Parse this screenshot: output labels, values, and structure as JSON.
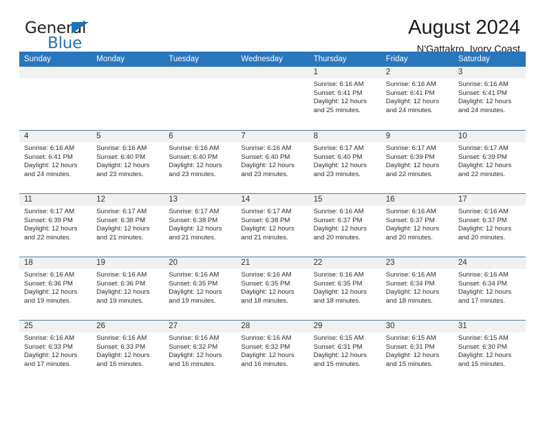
{
  "brand": {
    "name_top": "General",
    "name_bottom": "Blue",
    "accent_color": "#1f73b7"
  },
  "header": {
    "title": "August 2024",
    "subtitle": "N'Gattakro, Ivory Coast"
  },
  "calendar": {
    "header_bg": "#2a76bd",
    "date_band_bg": "#f1f1f1",
    "row_border_color": "#4a7ba8",
    "weekdays": [
      "Sunday",
      "Monday",
      "Tuesday",
      "Wednesday",
      "Thursday",
      "Friday",
      "Saturday"
    ],
    "weeks": [
      [
        {
          "day": "",
          "sunrise": "",
          "sunset": "",
          "daylight_line1": "",
          "daylight_line2": ""
        },
        {
          "day": "",
          "sunrise": "",
          "sunset": "",
          "daylight_line1": "",
          "daylight_line2": ""
        },
        {
          "day": "",
          "sunrise": "",
          "sunset": "",
          "daylight_line1": "",
          "daylight_line2": ""
        },
        {
          "day": "",
          "sunrise": "",
          "sunset": "",
          "daylight_line1": "",
          "daylight_line2": ""
        },
        {
          "day": "1",
          "sunrise": "Sunrise: 6:16 AM",
          "sunset": "Sunset: 6:41 PM",
          "daylight_line1": "Daylight: 12 hours",
          "daylight_line2": "and 25 minutes."
        },
        {
          "day": "2",
          "sunrise": "Sunrise: 6:16 AM",
          "sunset": "Sunset: 6:41 PM",
          "daylight_line1": "Daylight: 12 hours",
          "daylight_line2": "and 24 minutes."
        },
        {
          "day": "3",
          "sunrise": "Sunrise: 6:16 AM",
          "sunset": "Sunset: 6:41 PM",
          "daylight_line1": "Daylight: 12 hours",
          "daylight_line2": "and 24 minutes."
        }
      ],
      [
        {
          "day": "4",
          "sunrise": "Sunrise: 6:16 AM",
          "sunset": "Sunset: 6:41 PM",
          "daylight_line1": "Daylight: 12 hours",
          "daylight_line2": "and 24 minutes."
        },
        {
          "day": "5",
          "sunrise": "Sunrise: 6:16 AM",
          "sunset": "Sunset: 6:40 PM",
          "daylight_line1": "Daylight: 12 hours",
          "daylight_line2": "and 23 minutes."
        },
        {
          "day": "6",
          "sunrise": "Sunrise: 6:16 AM",
          "sunset": "Sunset: 6:40 PM",
          "daylight_line1": "Daylight: 12 hours",
          "daylight_line2": "and 23 minutes."
        },
        {
          "day": "7",
          "sunrise": "Sunrise: 6:16 AM",
          "sunset": "Sunset: 6:40 PM",
          "daylight_line1": "Daylight: 12 hours",
          "daylight_line2": "and 23 minutes."
        },
        {
          "day": "8",
          "sunrise": "Sunrise: 6:17 AM",
          "sunset": "Sunset: 6:40 PM",
          "daylight_line1": "Daylight: 12 hours",
          "daylight_line2": "and 23 minutes."
        },
        {
          "day": "9",
          "sunrise": "Sunrise: 6:17 AM",
          "sunset": "Sunset: 6:39 PM",
          "daylight_line1": "Daylight: 12 hours",
          "daylight_line2": "and 22 minutes."
        },
        {
          "day": "10",
          "sunrise": "Sunrise: 6:17 AM",
          "sunset": "Sunset: 6:39 PM",
          "daylight_line1": "Daylight: 12 hours",
          "daylight_line2": "and 22 minutes."
        }
      ],
      [
        {
          "day": "11",
          "sunrise": "Sunrise: 6:17 AM",
          "sunset": "Sunset: 6:39 PM",
          "daylight_line1": "Daylight: 12 hours",
          "daylight_line2": "and 22 minutes."
        },
        {
          "day": "12",
          "sunrise": "Sunrise: 6:17 AM",
          "sunset": "Sunset: 6:38 PM",
          "daylight_line1": "Daylight: 12 hours",
          "daylight_line2": "and 21 minutes."
        },
        {
          "day": "13",
          "sunrise": "Sunrise: 6:17 AM",
          "sunset": "Sunset: 6:38 PM",
          "daylight_line1": "Daylight: 12 hours",
          "daylight_line2": "and 21 minutes."
        },
        {
          "day": "14",
          "sunrise": "Sunrise: 6:17 AM",
          "sunset": "Sunset: 6:38 PM",
          "daylight_line1": "Daylight: 12 hours",
          "daylight_line2": "and 21 minutes."
        },
        {
          "day": "15",
          "sunrise": "Sunrise: 6:16 AM",
          "sunset": "Sunset: 6:37 PM",
          "daylight_line1": "Daylight: 12 hours",
          "daylight_line2": "and 20 minutes."
        },
        {
          "day": "16",
          "sunrise": "Sunrise: 6:16 AM",
          "sunset": "Sunset: 6:37 PM",
          "daylight_line1": "Daylight: 12 hours",
          "daylight_line2": "and 20 minutes."
        },
        {
          "day": "17",
          "sunrise": "Sunrise: 6:16 AM",
          "sunset": "Sunset: 6:37 PM",
          "daylight_line1": "Daylight: 12 hours",
          "daylight_line2": "and 20 minutes."
        }
      ],
      [
        {
          "day": "18",
          "sunrise": "Sunrise: 6:16 AM",
          "sunset": "Sunset: 6:36 PM",
          "daylight_line1": "Daylight: 12 hours",
          "daylight_line2": "and 19 minutes."
        },
        {
          "day": "19",
          "sunrise": "Sunrise: 6:16 AM",
          "sunset": "Sunset: 6:36 PM",
          "daylight_line1": "Daylight: 12 hours",
          "daylight_line2": "and 19 minutes."
        },
        {
          "day": "20",
          "sunrise": "Sunrise: 6:16 AM",
          "sunset": "Sunset: 6:35 PM",
          "daylight_line1": "Daylight: 12 hours",
          "daylight_line2": "and 19 minutes."
        },
        {
          "day": "21",
          "sunrise": "Sunrise: 6:16 AM",
          "sunset": "Sunset: 6:35 PM",
          "daylight_line1": "Daylight: 12 hours",
          "daylight_line2": "and 18 minutes."
        },
        {
          "day": "22",
          "sunrise": "Sunrise: 6:16 AM",
          "sunset": "Sunset: 6:35 PM",
          "daylight_line1": "Daylight: 12 hours",
          "daylight_line2": "and 18 minutes."
        },
        {
          "day": "23",
          "sunrise": "Sunrise: 6:16 AM",
          "sunset": "Sunset: 6:34 PM",
          "daylight_line1": "Daylight: 12 hours",
          "daylight_line2": "and 18 minutes."
        },
        {
          "day": "24",
          "sunrise": "Sunrise: 6:16 AM",
          "sunset": "Sunset: 6:34 PM",
          "daylight_line1": "Daylight: 12 hours",
          "daylight_line2": "and 17 minutes."
        }
      ],
      [
        {
          "day": "25",
          "sunrise": "Sunrise: 6:16 AM",
          "sunset": "Sunset: 6:33 PM",
          "daylight_line1": "Daylight: 12 hours",
          "daylight_line2": "and 17 minutes."
        },
        {
          "day": "26",
          "sunrise": "Sunrise: 6:16 AM",
          "sunset": "Sunset: 6:33 PM",
          "daylight_line1": "Daylight: 12 hours",
          "daylight_line2": "and 16 minutes."
        },
        {
          "day": "27",
          "sunrise": "Sunrise: 6:16 AM",
          "sunset": "Sunset: 6:32 PM",
          "daylight_line1": "Daylight: 12 hours",
          "daylight_line2": "and 16 minutes."
        },
        {
          "day": "28",
          "sunrise": "Sunrise: 6:16 AM",
          "sunset": "Sunset: 6:32 PM",
          "daylight_line1": "Daylight: 12 hours",
          "daylight_line2": "and 16 minutes."
        },
        {
          "day": "29",
          "sunrise": "Sunrise: 6:15 AM",
          "sunset": "Sunset: 6:31 PM",
          "daylight_line1": "Daylight: 12 hours",
          "daylight_line2": "and 15 minutes."
        },
        {
          "day": "30",
          "sunrise": "Sunrise: 6:15 AM",
          "sunset": "Sunset: 6:31 PM",
          "daylight_line1": "Daylight: 12 hours",
          "daylight_line2": "and 15 minutes."
        },
        {
          "day": "31",
          "sunrise": "Sunrise: 6:15 AM",
          "sunset": "Sunset: 6:30 PM",
          "daylight_line1": "Daylight: 12 hours",
          "daylight_line2": "and 15 minutes."
        }
      ]
    ]
  }
}
